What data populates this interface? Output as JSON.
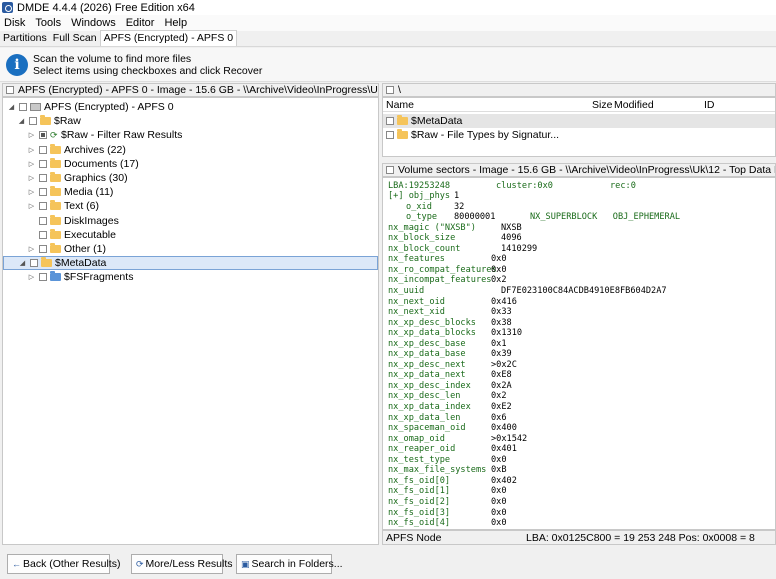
{
  "window": {
    "title": "DMDE 4.4.4 (2026) Free Edition x64"
  },
  "menu": [
    "Disk",
    "Tools",
    "Windows",
    "Editor",
    "Help"
  ],
  "tabs": [
    "Partitions",
    "Full Scan",
    "APFS (Encrypted) - APFS 0"
  ],
  "info": {
    "line1": "Scan the volume to find more files",
    "line2": "Select items using checkboxes and click Recover"
  },
  "tree_header": "APFS (Encrypted) - APFS 0 - Image - 15.6 GB - \\\\Archive\\Video\\InProgress\\Uk\\12 - Top ...",
  "tree": [
    {
      "label": "APFS (Encrypted) - APFS 0",
      "level": 0,
      "exp": "open",
      "icon": "drive"
    },
    {
      "label": "$Raw",
      "level": 1,
      "exp": "open",
      "icon": "folder"
    },
    {
      "label": "$Raw - Filter Raw Results",
      "level": 2,
      "exp": "closed",
      "icon": "refresh"
    },
    {
      "label": "Archives (22)",
      "level": 2,
      "exp": "closed",
      "icon": "folder"
    },
    {
      "label": "Documents (17)",
      "level": 2,
      "exp": "closed",
      "icon": "folder"
    },
    {
      "label": "Graphics (30)",
      "level": 2,
      "exp": "closed",
      "icon": "folder"
    },
    {
      "label": "Media (11)",
      "level": 2,
      "exp": "closed",
      "icon": "folder"
    },
    {
      "label": "Text (6)",
      "level": 2,
      "exp": "closed",
      "icon": "folder"
    },
    {
      "label": "DiskImages",
      "level": 2,
      "exp": "none",
      "icon": "folder"
    },
    {
      "label": "Executable",
      "level": 2,
      "exp": "none",
      "icon": "folder"
    },
    {
      "label": "Other (1)",
      "level": 2,
      "exp": "closed",
      "icon": "folder"
    },
    {
      "label": "$MetaData",
      "level": 1,
      "exp": "open",
      "icon": "folder",
      "selected": true
    },
    {
      "label": "$FSFragments",
      "level": 2,
      "exp": "closed",
      "icon": "folder-blue"
    }
  ],
  "files_header": "\\",
  "files_columns": {
    "name": "Name",
    "size": "Size",
    "modified": "Modified",
    "id": "ID"
  },
  "files": [
    {
      "name": "$MetaData",
      "selected": true
    },
    {
      "name": "$Raw - File Types by Signatur..."
    }
  ],
  "hex_header": "Volume sectors - Image - 15.6 GB - \\\\Archive\\Video\\InProgress\\Uk\\12 - Top Data Recovery Software",
  "hex_top": {
    "lba": "LBA:19253248",
    "cluster": "cluster:0x0",
    "rec": "rec:0"
  },
  "hex_obj": [
    {
      "label": "[+] obj_phys",
      "value": "1",
      "indent": 0
    },
    {
      "label": "o_xid",
      "value": "32",
      "indent": 1
    },
    {
      "label": "o_type",
      "value": "80000001",
      "extra": "NX_SUPERBLOCK   OBJ_EPHEMERAL",
      "indent": 1
    }
  ],
  "hex_fields": [
    {
      "k": "nx_magic (\"NXSB\")",
      "v": "NXSB",
      "col": 1
    },
    {
      "k": "nx_block_size",
      "v": "4096",
      "col": 1
    },
    {
      "k": "nx_block_count",
      "v": "1410299",
      "col": 1
    },
    {
      "k": "nx_features",
      "v": "0x0",
      "col": 0
    },
    {
      "k": "nx_ro_compat_features",
      "v": "0x0",
      "col": 0
    },
    {
      "k": "nx_incompat_features",
      "v": "0x2",
      "col": 0
    },
    {
      "k": "nx_uuid",
      "v": "DF7E023100C84ACDB4910E8FB604D2A7",
      "col": 1
    },
    {
      "k": "nx_next_oid",
      "v": "0x416",
      "col": 0
    },
    {
      "k": "nx_next_xid",
      "v": "0x33",
      "col": 0
    },
    {
      "k": "nx_xp_desc_blocks",
      "v": "0x38",
      "col": 0
    },
    {
      "k": "nx_xp_data_blocks",
      "v": "0x1310",
      "col": 0
    },
    {
      "k": "nx_xp_desc_base",
      "v": "0x1",
      "col": 0
    },
    {
      "k": "nx_xp_data_base",
      "v": "0x39",
      "col": 0
    },
    {
      "k": "nx_xp_desc_next",
      "v": ">0x2C",
      "col": 0
    },
    {
      "k": "nx_xp_data_next",
      "v": "0xE8",
      "col": 0
    },
    {
      "k": "nx_xp_desc_index",
      "v": "0x2A",
      "col": 0
    },
    {
      "k": "nx_xp_desc_len",
      "v": "0x2",
      "col": 0
    },
    {
      "k": "nx_xp_data_index",
      "v": "0xE2",
      "col": 0
    },
    {
      "k": "nx_xp_data_len",
      "v": "0x6",
      "col": 0
    },
    {
      "k": "nx_spaceman_oid",
      "v": "0x400",
      "col": 0
    },
    {
      "k": "nx_omap_oid",
      "v": ">0x1542",
      "col": 0
    },
    {
      "k": "nx_reaper_oid",
      "v": "0x401",
      "col": 0
    },
    {
      "k": "nx_test_type",
      "v": "0x0",
      "col": 0
    },
    {
      "k": "nx_max_file_systems",
      "v": "0xB",
      "col": 0
    },
    {
      "k": "nx_fs_oid[0]",
      "v": "0x402",
      "col": 0
    },
    {
      "k": "nx_fs_oid[1]",
      "v": "0x0",
      "col": 0
    },
    {
      "k": "nx_fs_oid[2]",
      "v": "0x0",
      "col": 0
    },
    {
      "k": "nx_fs_oid[3]",
      "v": "0x0",
      "col": 0
    },
    {
      "k": "nx_fs_oid[4]",
      "v": "0x0",
      "col": 0
    }
  ],
  "status": {
    "left": "APFS Node",
    "right": "LBA: 0x0125C800 = 19 253 248  Pos: 0x0008 = 8"
  },
  "buttons": {
    "back": "Back (Other Results)",
    "more_less": "More/Less Results",
    "search": "Search in Folders..."
  },
  "colors": {
    "accent": "#1a6fc0",
    "hex_key": "#1a6b1a",
    "selection": "#dce8f8"
  }
}
